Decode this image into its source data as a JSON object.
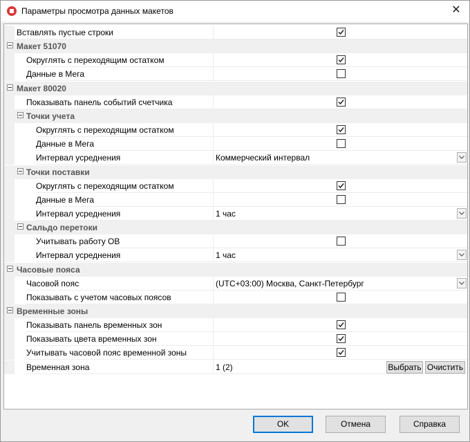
{
  "window": {
    "title": "Параметры просмотра данных макетов"
  },
  "rows": [
    {
      "type": "prop",
      "level": 0,
      "label": "Вставлять пустые строки",
      "value_type": "checkbox",
      "checked": true
    },
    {
      "type": "cat",
      "level": 0,
      "label": "Макет 51070"
    },
    {
      "type": "prop",
      "level": 1,
      "label": "Округлять с переходящим остатком",
      "value_type": "checkbox",
      "checked": true
    },
    {
      "type": "prop",
      "level": 1,
      "label": "Данные в Мега",
      "value_type": "checkbox",
      "checked": false
    },
    {
      "type": "cat",
      "level": 0,
      "label": "Макет 80020"
    },
    {
      "type": "prop",
      "level": 1,
      "label": "Показывать панель событий счетчика",
      "value_type": "checkbox",
      "checked": true
    },
    {
      "type": "cat",
      "level": 1,
      "label": "Точки учета"
    },
    {
      "type": "prop",
      "level": 2,
      "label": "Округлять с переходящим остатком",
      "value_type": "checkbox",
      "checked": true
    },
    {
      "type": "prop",
      "level": 2,
      "label": "Данные в Мега",
      "value_type": "checkbox",
      "checked": false
    },
    {
      "type": "prop",
      "level": 2,
      "label": "Интервал усреднения",
      "value_type": "dropdown",
      "value": "Коммерческий интервал"
    },
    {
      "type": "cat",
      "level": 1,
      "label": "Точки поставки"
    },
    {
      "type": "prop",
      "level": 2,
      "label": "Округлять с переходящим остатком",
      "value_type": "checkbox",
      "checked": true
    },
    {
      "type": "prop",
      "level": 2,
      "label": "Данные в Мега",
      "value_type": "checkbox",
      "checked": false
    },
    {
      "type": "prop",
      "level": 2,
      "label": "Интервал усреднения",
      "value_type": "dropdown",
      "value": "1 час"
    },
    {
      "type": "cat",
      "level": 1,
      "label": "Сальдо перетоки"
    },
    {
      "type": "prop",
      "level": 2,
      "label": "Учитывать работу ОВ",
      "value_type": "checkbox",
      "checked": false
    },
    {
      "type": "prop",
      "level": 2,
      "label": "Интервал усреднения",
      "value_type": "dropdown",
      "value": "1 час"
    },
    {
      "type": "cat",
      "level": 0,
      "label": "Часовые пояса"
    },
    {
      "type": "prop",
      "level": 1,
      "label": "Часовой пояс",
      "value_type": "dropdown",
      "value": "(UTC+03:00) Москва, Санкт-Петербург"
    },
    {
      "type": "prop",
      "level": 1,
      "label": "Показывать с учетом часовых поясов",
      "value_type": "checkbox",
      "checked": false
    },
    {
      "type": "cat",
      "level": 0,
      "label": "Временные зоны"
    },
    {
      "type": "prop",
      "level": 1,
      "label": "Показывать панель временных зон",
      "value_type": "checkbox",
      "checked": true
    },
    {
      "type": "prop",
      "level": 1,
      "label": "Показывать цвета временных зон",
      "value_type": "checkbox",
      "checked": true
    },
    {
      "type": "prop",
      "level": 1,
      "label": "Учитывать часовой пояс временной зоны",
      "value_type": "checkbox",
      "checked": true
    },
    {
      "type": "prop",
      "level": 1,
      "label": "Временная зона",
      "value_type": "text_buttons",
      "value": "1 (2)",
      "buttons": [
        "Выбрать",
        "Очистить"
      ]
    }
  ],
  "footer": {
    "ok": "OK",
    "cancel": "Отмена",
    "help": "Справка"
  },
  "colors": {
    "accent": "#0078d7",
    "category_bg": "#f0f0f0",
    "category_text": "#555555"
  }
}
